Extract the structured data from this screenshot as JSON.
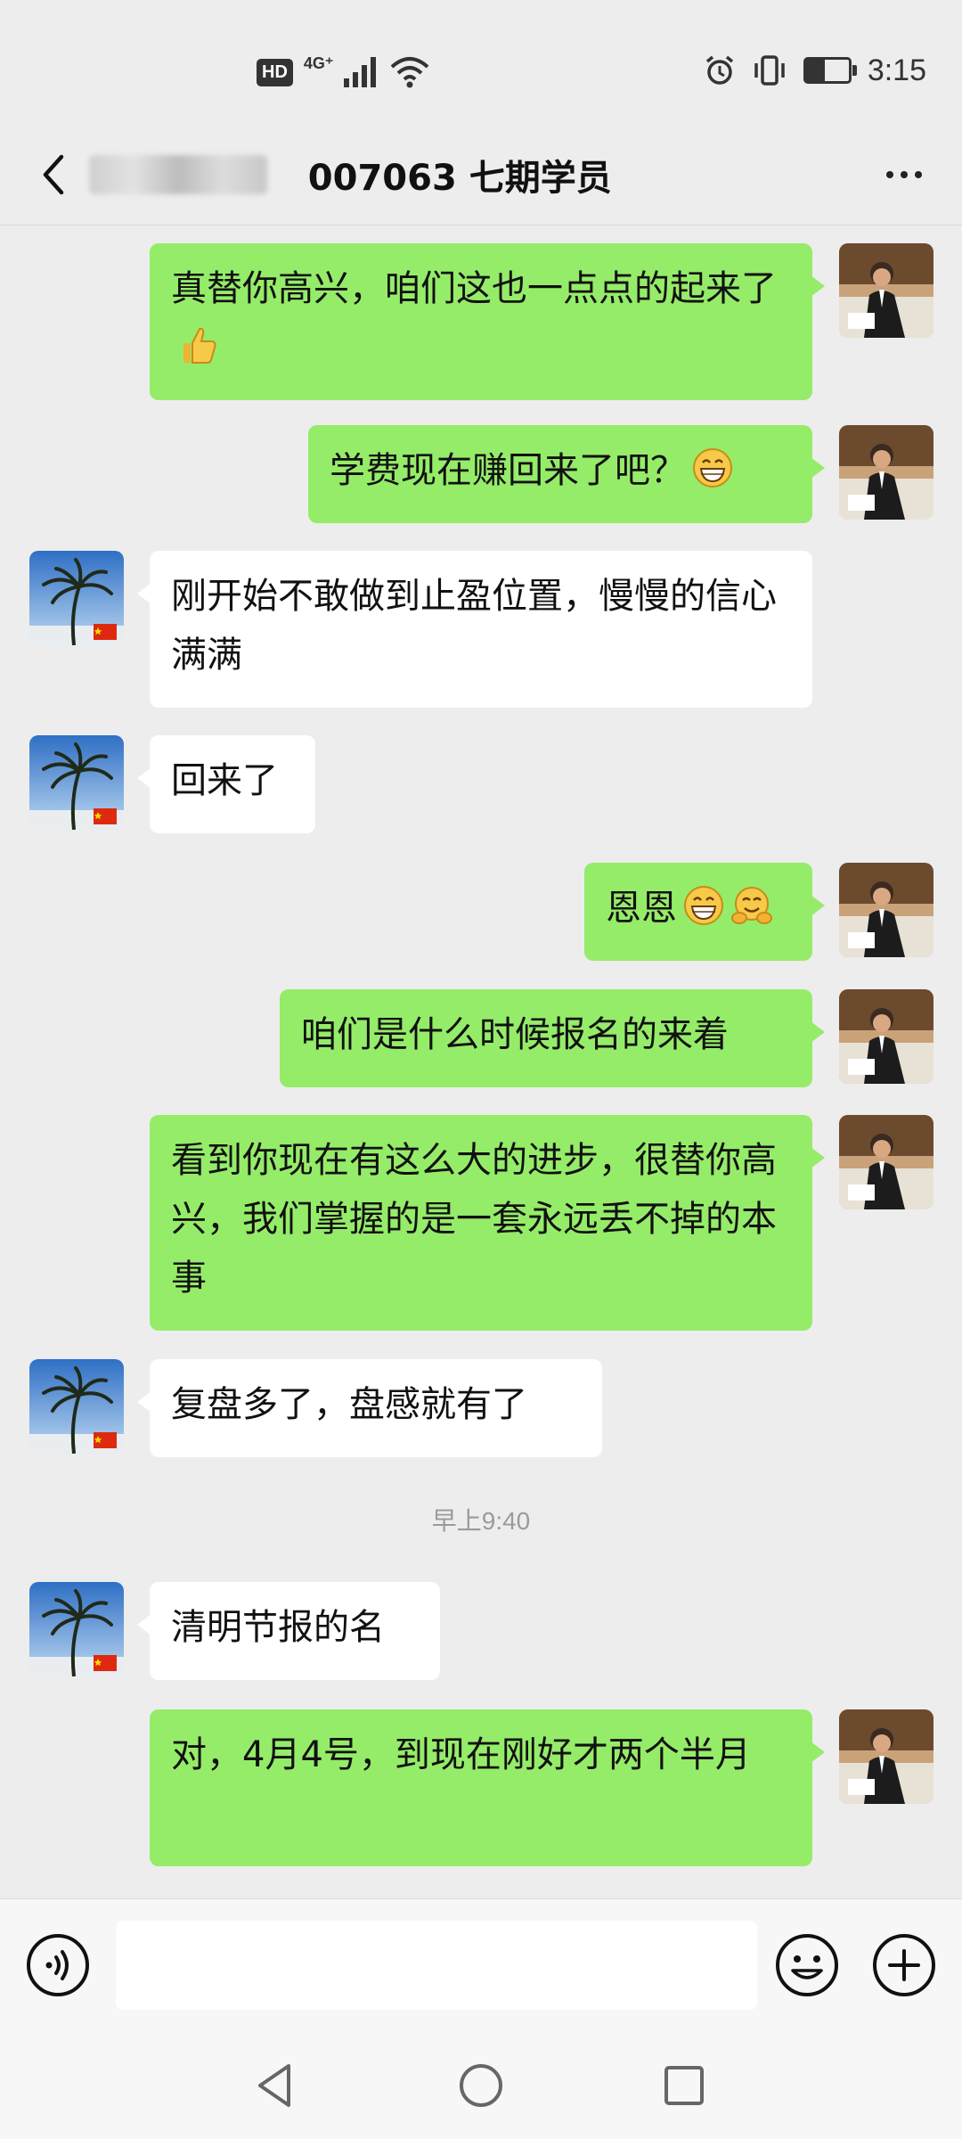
{
  "status_bar": {
    "hd_label": "HD",
    "network_label": "4G⁺",
    "time": "3:15",
    "battery_level": 0.45
  },
  "header": {
    "title": "   007063 七期学员",
    "back_icon": "chevron-left-icon",
    "more_icon": "more-dots-icon"
  },
  "messages": [
    {
      "side": "out",
      "text": "真替你高兴，咱们这也一点点的起来了",
      "emoji": [
        "thumbs-up"
      ]
    },
    {
      "side": "out",
      "text": "学费现在赚回来了吧？",
      "emoji": [
        "grin"
      ]
    },
    {
      "side": "in",
      "text": "刚开始不敢做到止盈位置，慢慢的信心满满",
      "emoji": []
    },
    {
      "side": "in",
      "text": "回来了",
      "emoji": []
    },
    {
      "side": "out",
      "text": "恩恩",
      "emoji": [
        "grin",
        "hug"
      ]
    },
    {
      "side": "out",
      "text": "咱们是什么时候报名的来着",
      "emoji": []
    },
    {
      "side": "out",
      "text": "看到你现在有这么大的进步，很替你高兴，我们掌握的是一套永远丢不掉的本事",
      "emoji": []
    },
    {
      "side": "in",
      "text": "复盘多了，盘感就有了",
      "emoji": []
    },
    {
      "type": "timestamp",
      "text": "早上9:40"
    },
    {
      "side": "in",
      "text": "清明节报的名",
      "emoji": []
    },
    {
      "side": "out",
      "text": "对，4月4号，到现在刚好才两个半月",
      "emoji": []
    }
  ],
  "input_bar": {
    "placeholder": "",
    "voice_icon": "voice-icon",
    "emoji_icon": "emoji-smile-icon",
    "plus_icon": "plus-circle-icon"
  },
  "nav_bar": {
    "back_icon": "nav-back-triangle-icon",
    "home_icon": "nav-home-circle-icon",
    "recents_icon": "nav-recents-square-icon"
  },
  "colors": {
    "background": "#ededed",
    "outgoing_bubble": "#95ec69",
    "incoming_bubble": "#ffffff",
    "timestamp_text": "#9a9a9a"
  }
}
